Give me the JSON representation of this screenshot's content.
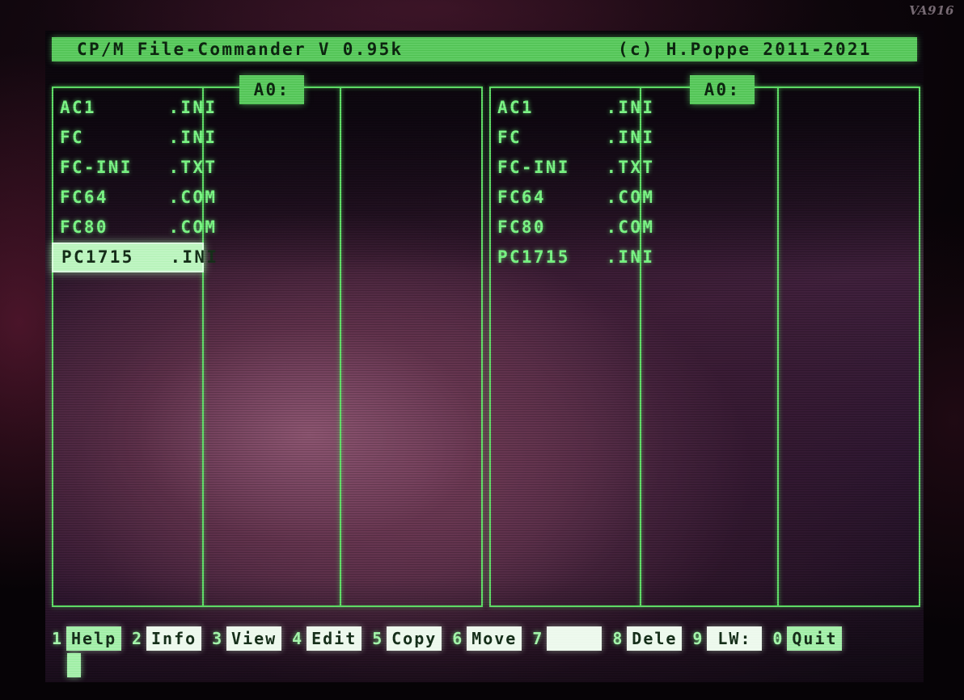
{
  "watermark": "VA916",
  "titlebar": {
    "title": "CP/M File-Commander V 0.95k",
    "copyright": "(c) H.Poppe 2011-2021"
  },
  "panels": {
    "left": {
      "drive_label": "A0:",
      "files": [
        {
          "name": "AC1",
          "ext": ".INI",
          "selected": false
        },
        {
          "name": "FC",
          "ext": ".INI",
          "selected": false
        },
        {
          "name": "FC-INI",
          "ext": ".TXT",
          "selected": false
        },
        {
          "name": "FC64",
          "ext": ".COM",
          "selected": false
        },
        {
          "name": "FC80",
          "ext": ".COM",
          "selected": false
        },
        {
          "name": "PC1715",
          "ext": ".INI",
          "selected": true
        }
      ],
      "rows": [
        "AC1      .INI",
        "FC       .INI",
        "FC-INI   .TXT",
        "FC64     .COM",
        "FC80     .COM",
        "PC1715   .INI"
      ]
    },
    "right": {
      "drive_label": "A0:",
      "files": [
        {
          "name": "AC1",
          "ext": ".INI",
          "selected": false
        },
        {
          "name": "FC",
          "ext": ".INI",
          "selected": false
        },
        {
          "name": "FC-INI",
          "ext": ".TXT",
          "selected": false
        },
        {
          "name": "FC64",
          "ext": ".COM",
          "selected": false
        },
        {
          "name": "FC80",
          "ext": ".COM",
          "selected": false
        },
        {
          "name": "PC1715",
          "ext": ".INI",
          "selected": false
        }
      ],
      "rows": [
        "AC1      .INI",
        "FC       .INI",
        "FC-INI   .TXT",
        "FC64     .COM",
        "FC80     .COM",
        "PC1715   .INI"
      ]
    }
  },
  "function_keys": [
    {
      "num": "1",
      "label": "Help",
      "accent": true
    },
    {
      "num": "2",
      "label": "Info",
      "accent": false
    },
    {
      "num": "3",
      "label": "View",
      "accent": false
    },
    {
      "num": "4",
      "label": "Edit",
      "accent": false
    },
    {
      "num": "5",
      "label": "Copy",
      "accent": false
    },
    {
      "num": "6",
      "label": "Move",
      "accent": false
    },
    {
      "num": "7",
      "label": " ",
      "accent": false
    },
    {
      "num": "8",
      "label": "Dele",
      "accent": false
    },
    {
      "num": "9",
      "label": "LW:",
      "accent": false
    },
    {
      "num": "0",
      "label": "Quit",
      "accent": true
    }
  ],
  "colors": {
    "phosphor_green": "#7ef288",
    "bar_green": "#5ecb62",
    "highlight_green": "#bff5c2",
    "key_white": "#eef9ee",
    "screen_purple": "#6d3a56"
  }
}
